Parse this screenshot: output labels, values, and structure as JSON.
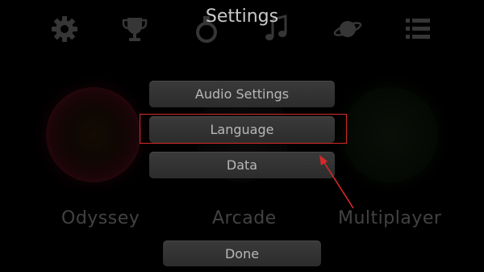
{
  "top_bar": {
    "title": "Settings",
    "icons": [
      "gear-icon",
      "trophy-icon",
      "achievement-icon",
      "music-icon",
      "planet-icon",
      "list-icon"
    ]
  },
  "game_modes": [
    {
      "label": "Odyssey"
    },
    {
      "label": "Arcade"
    },
    {
      "label": "Multiplayer"
    }
  ],
  "settings_menu": {
    "audio_label": "Audio Settings",
    "language_label": "Language",
    "data_label": "Data",
    "done_label": "Done"
  },
  "annotation": {
    "highlight_color": "#d62a2a",
    "highlighted_item": "Language"
  },
  "colors": {
    "background": "#000000",
    "button": "#333333",
    "text": "#b8b8b8"
  }
}
